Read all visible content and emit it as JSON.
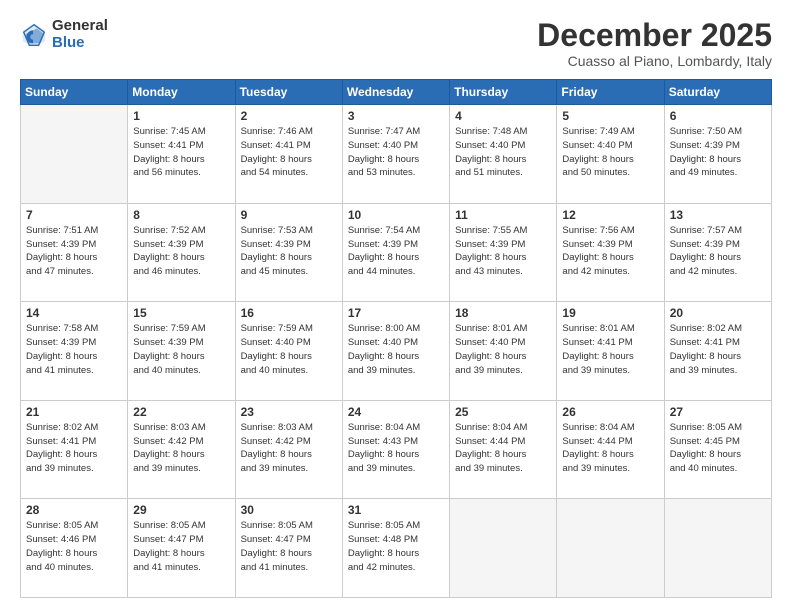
{
  "logo": {
    "general": "General",
    "blue": "Blue"
  },
  "header": {
    "month": "December 2025",
    "location": "Cuasso al Piano, Lombardy, Italy"
  },
  "days": [
    "Sunday",
    "Monday",
    "Tuesday",
    "Wednesday",
    "Thursday",
    "Friday",
    "Saturday"
  ],
  "weeks": [
    [
      {
        "day": "",
        "content": ""
      },
      {
        "day": "1",
        "content": "Sunrise: 7:45 AM\nSunset: 4:41 PM\nDaylight: 8 hours\nand 56 minutes."
      },
      {
        "day": "2",
        "content": "Sunrise: 7:46 AM\nSunset: 4:41 PM\nDaylight: 8 hours\nand 54 minutes."
      },
      {
        "day": "3",
        "content": "Sunrise: 7:47 AM\nSunset: 4:40 PM\nDaylight: 8 hours\nand 53 minutes."
      },
      {
        "day": "4",
        "content": "Sunrise: 7:48 AM\nSunset: 4:40 PM\nDaylight: 8 hours\nand 51 minutes."
      },
      {
        "day": "5",
        "content": "Sunrise: 7:49 AM\nSunset: 4:40 PM\nDaylight: 8 hours\nand 50 minutes."
      },
      {
        "day": "6",
        "content": "Sunrise: 7:50 AM\nSunset: 4:39 PM\nDaylight: 8 hours\nand 49 minutes."
      }
    ],
    [
      {
        "day": "7",
        "content": "Sunrise: 7:51 AM\nSunset: 4:39 PM\nDaylight: 8 hours\nand 47 minutes."
      },
      {
        "day": "8",
        "content": "Sunrise: 7:52 AM\nSunset: 4:39 PM\nDaylight: 8 hours\nand 46 minutes."
      },
      {
        "day": "9",
        "content": "Sunrise: 7:53 AM\nSunset: 4:39 PM\nDaylight: 8 hours\nand 45 minutes."
      },
      {
        "day": "10",
        "content": "Sunrise: 7:54 AM\nSunset: 4:39 PM\nDaylight: 8 hours\nand 44 minutes."
      },
      {
        "day": "11",
        "content": "Sunrise: 7:55 AM\nSunset: 4:39 PM\nDaylight: 8 hours\nand 43 minutes."
      },
      {
        "day": "12",
        "content": "Sunrise: 7:56 AM\nSunset: 4:39 PM\nDaylight: 8 hours\nand 42 minutes."
      },
      {
        "day": "13",
        "content": "Sunrise: 7:57 AM\nSunset: 4:39 PM\nDaylight: 8 hours\nand 42 minutes."
      }
    ],
    [
      {
        "day": "14",
        "content": "Sunrise: 7:58 AM\nSunset: 4:39 PM\nDaylight: 8 hours\nand 41 minutes."
      },
      {
        "day": "15",
        "content": "Sunrise: 7:59 AM\nSunset: 4:39 PM\nDaylight: 8 hours\nand 40 minutes."
      },
      {
        "day": "16",
        "content": "Sunrise: 7:59 AM\nSunset: 4:40 PM\nDaylight: 8 hours\nand 40 minutes."
      },
      {
        "day": "17",
        "content": "Sunrise: 8:00 AM\nSunset: 4:40 PM\nDaylight: 8 hours\nand 39 minutes."
      },
      {
        "day": "18",
        "content": "Sunrise: 8:01 AM\nSunset: 4:40 PM\nDaylight: 8 hours\nand 39 minutes."
      },
      {
        "day": "19",
        "content": "Sunrise: 8:01 AM\nSunset: 4:41 PM\nDaylight: 8 hours\nand 39 minutes."
      },
      {
        "day": "20",
        "content": "Sunrise: 8:02 AM\nSunset: 4:41 PM\nDaylight: 8 hours\nand 39 minutes."
      }
    ],
    [
      {
        "day": "21",
        "content": "Sunrise: 8:02 AM\nSunset: 4:41 PM\nDaylight: 8 hours\nand 39 minutes."
      },
      {
        "day": "22",
        "content": "Sunrise: 8:03 AM\nSunset: 4:42 PM\nDaylight: 8 hours\nand 39 minutes."
      },
      {
        "day": "23",
        "content": "Sunrise: 8:03 AM\nSunset: 4:42 PM\nDaylight: 8 hours\nand 39 minutes."
      },
      {
        "day": "24",
        "content": "Sunrise: 8:04 AM\nSunset: 4:43 PM\nDaylight: 8 hours\nand 39 minutes."
      },
      {
        "day": "25",
        "content": "Sunrise: 8:04 AM\nSunset: 4:44 PM\nDaylight: 8 hours\nand 39 minutes."
      },
      {
        "day": "26",
        "content": "Sunrise: 8:04 AM\nSunset: 4:44 PM\nDaylight: 8 hours\nand 39 minutes."
      },
      {
        "day": "27",
        "content": "Sunrise: 8:05 AM\nSunset: 4:45 PM\nDaylight: 8 hours\nand 40 minutes."
      }
    ],
    [
      {
        "day": "28",
        "content": "Sunrise: 8:05 AM\nSunset: 4:46 PM\nDaylight: 8 hours\nand 40 minutes."
      },
      {
        "day": "29",
        "content": "Sunrise: 8:05 AM\nSunset: 4:47 PM\nDaylight: 8 hours\nand 41 minutes."
      },
      {
        "day": "30",
        "content": "Sunrise: 8:05 AM\nSunset: 4:47 PM\nDaylight: 8 hours\nand 41 minutes."
      },
      {
        "day": "31",
        "content": "Sunrise: 8:05 AM\nSunset: 4:48 PM\nDaylight: 8 hours\nand 42 minutes."
      },
      {
        "day": "",
        "content": ""
      },
      {
        "day": "",
        "content": ""
      },
      {
        "day": "",
        "content": ""
      }
    ]
  ]
}
